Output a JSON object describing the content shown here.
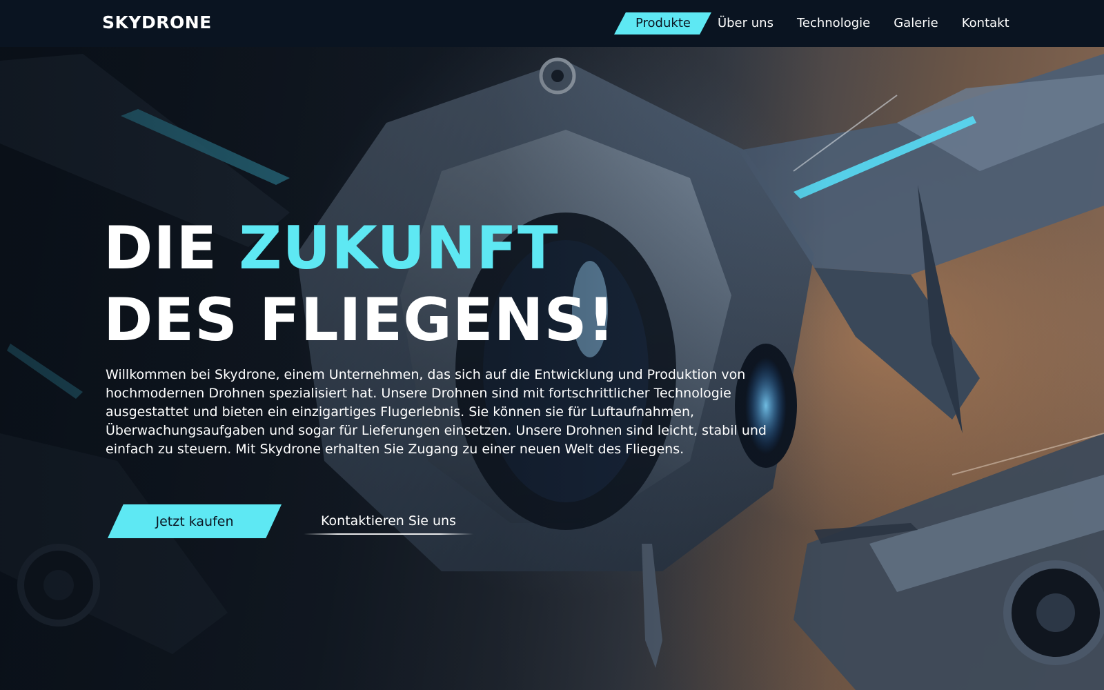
{
  "brand": {
    "name": "SKYDRONE"
  },
  "nav": {
    "items": [
      {
        "label": "Produkte",
        "active": true
      },
      {
        "label": "Über uns",
        "active": false
      },
      {
        "label": "Technologie",
        "active": false
      },
      {
        "label": "Galerie",
        "active": false
      },
      {
        "label": "Kontakt",
        "active": false
      }
    ]
  },
  "hero": {
    "headline_part1": "DIE ",
    "headline_accent": "ZUKUNFT",
    "headline_line2": "DES FLIEGENS!",
    "intro": "Willkommen bei Skydrone, einem Unternehmen, das sich auf die Entwicklung und Produktion von hochmodernen Drohnen spezialisiert hat. Unsere Drohnen sind mit fortschrittlicher Technologie ausgestattet und bieten ein einzigartiges Flugerlebnis. Sie können sie für Luftaufnahmen, Überwachungsaufgaben und sogar für Lieferungen einsetzen. Unsere Drohnen sind leicht, stabil und einfach zu steuern. Mit Skydrone erhalten Sie Zugang zu einer neuen Welt des Fliegens.",
    "primary_cta": "Jetzt kaufen",
    "secondary_cta": "Kontaktieren Sie uns",
    "background_image": "futuristic-drone-illustration"
  },
  "colors": {
    "accent": "#5ee8f3",
    "header_bg": "#0a1421",
    "text": "#ffffff"
  }
}
